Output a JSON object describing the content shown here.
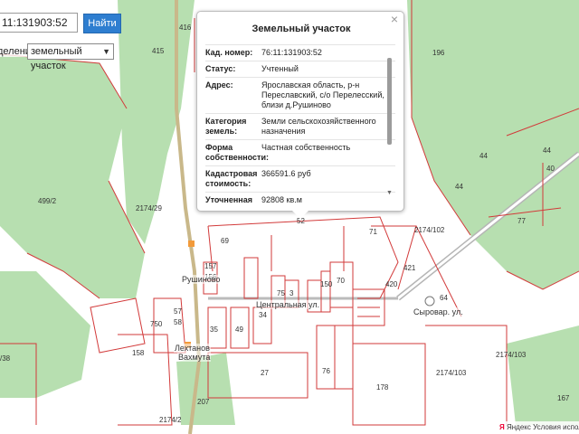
{
  "search": {
    "value": "11:131903:52",
    "button_label": "Найти",
    "division_label": "деление:",
    "division_value": "земельный участок"
  },
  "popup": {
    "title": "Земельный участок",
    "close": "×",
    "rows": [
      {
        "key": "Кад. номер:",
        "value": "76:11:131903:52"
      },
      {
        "key": "Статус:",
        "value": "Учтенный"
      },
      {
        "key": "Адрес:",
        "value": "Ярославская область, р-н Переславский, с/о Перелесский, близи д.Рушиново"
      },
      {
        "key": "Категория земель:",
        "value": "Земли сельскохозяйственного назначения"
      },
      {
        "key": "Форма собственности:",
        "value": "Частная собственность"
      },
      {
        "key": "Кадастровая стоимость:",
        "value": "366591.6 руб"
      },
      {
        "key": "Уточненная площадь:",
        "value": "92808 кв.м"
      }
    ]
  },
  "map": {
    "colors": {
      "forest": "#b7dfb0",
      "field": "#ffffff",
      "parcel_border": "#d23a3a",
      "road": "#b5b5b5"
    },
    "plot_labels": [
      "416",
      "415",
      "196",
      "499/2",
      "2174/29",
      "44",
      "40",
      "44",
      "44",
      "77",
      "71",
      "52",
      "69",
      "2174/102",
      "421",
      "420",
      "70",
      "64",
      "157",
      "156",
      "75",
      "3",
      "150",
      "750",
      "57",
      "58",
      "49",
      "35",
      "34",
      "158",
      "27",
      "76",
      "178",
      "2174/103",
      "2174/103",
      "167",
      "207",
      "2174/2",
      "/38"
    ],
    "place_labels": [
      "Рушиново",
      "Центральная ул.",
      "Сыровар. ул.",
      "Лехтанов",
      "Вахмута"
    ]
  },
  "footer": {
    "logo": "Я",
    "text": "Яндекс  Условия испол"
  }
}
